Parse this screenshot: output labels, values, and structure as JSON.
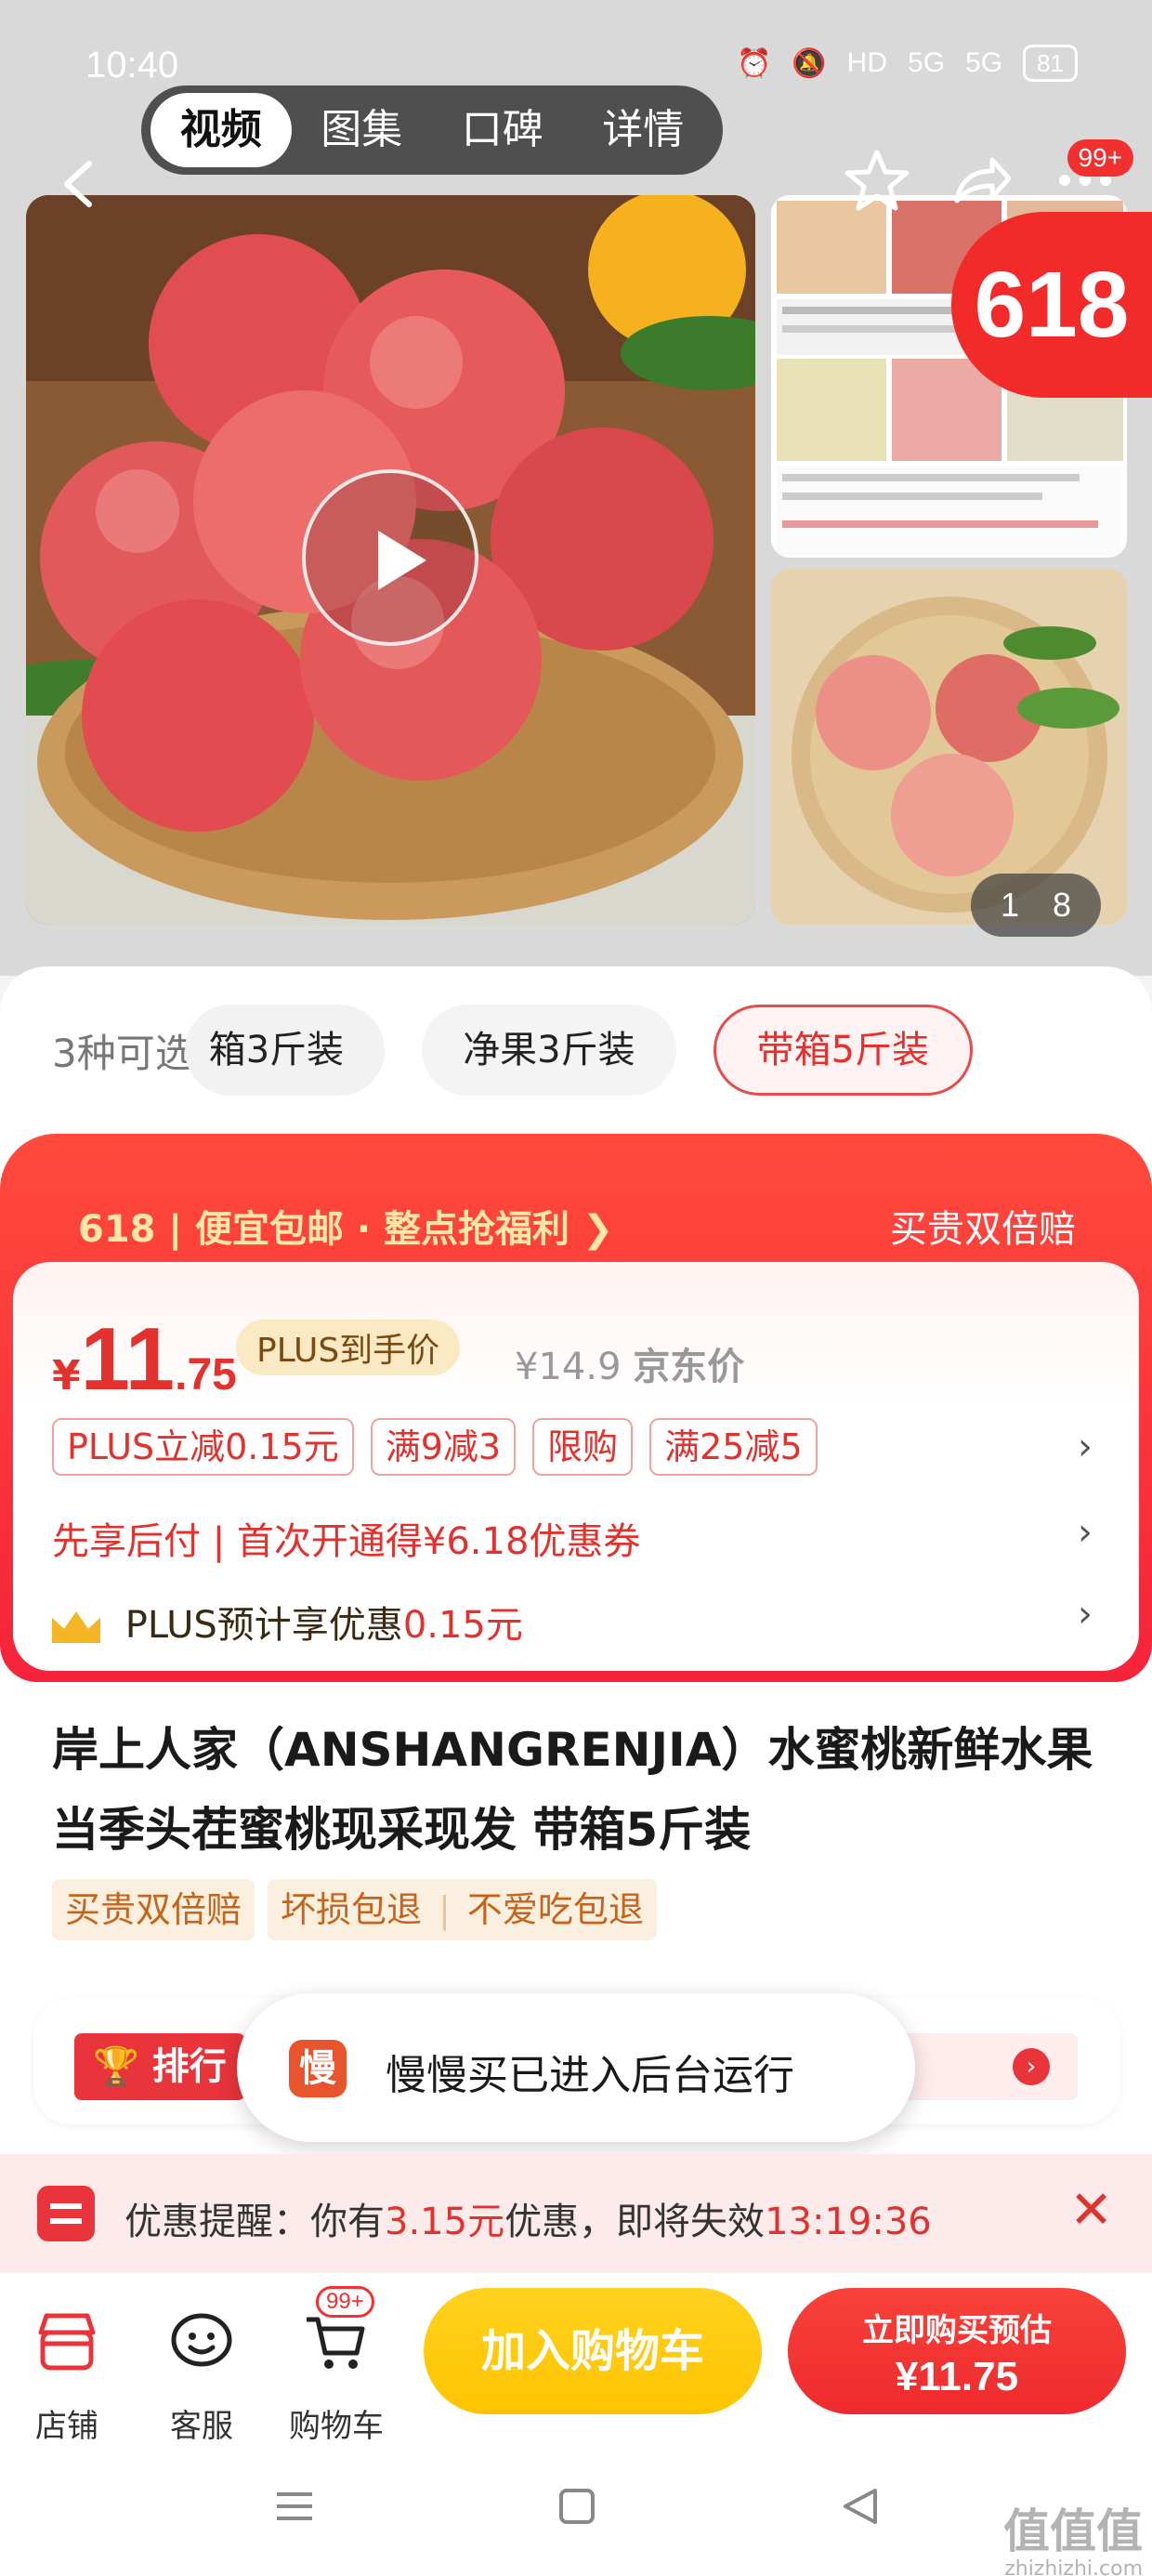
{
  "status_bar": {
    "time": "10:40",
    "hd": "HD",
    "net1": "5G",
    "net2": "5G",
    "battery": "81"
  },
  "media_tabs": [
    {
      "label": "视频",
      "active": true
    },
    {
      "label": "图集",
      "active": false
    },
    {
      "label": "口碑",
      "active": false
    },
    {
      "label": "详情",
      "active": false
    }
  ],
  "header": {
    "cart_badge": "99+",
    "promo_badge": "618",
    "image_counter": "1 8"
  },
  "variants": {
    "count_label": "3种可选",
    "options": [
      {
        "label": "箱3斤装",
        "active": false
      },
      {
        "label": "净果3斤装",
        "active": false
      },
      {
        "label": "带箱5斤装",
        "active": true
      }
    ]
  },
  "promo": {
    "title": "618 | 便宜包邮 · 整点抢福利 ❯",
    "right": "买贵双倍赔"
  },
  "price": {
    "currency": "¥",
    "integer": "11",
    "decimal": ".75",
    "plus_tag": "PLUS到手价",
    "jd_price": "¥14.9",
    "jd_label": "京东价"
  },
  "coupons": [
    "PLUS立减0.15元",
    "满9减3",
    "限购",
    "满25减5"
  ],
  "pay_later": "先享后付 | 首次开通得¥6.18优惠券",
  "plus_saving": {
    "prefix": "PLUS预计享优惠",
    "amount": "0.15元"
  },
  "product_title": "岸上人家（ANSHANGRENJIA）水蜜桃新鲜水果当季头茬蜜桃现采现发 带箱5斤装",
  "service_tags": [
    "买贵双倍赔",
    "坏损包退",
    "不爱吃包退"
  ],
  "ranking": {
    "label": "排行"
  },
  "toast": {
    "icon_text": "慢",
    "text": "慢慢买已进入后台运行"
  },
  "reminder": {
    "prefix": "优惠提醒：你有",
    "amount": "3.15元",
    "middle": "优惠，即将失效",
    "countdown": "13:19:36"
  },
  "bottom_bar": {
    "store": "店铺",
    "service": "客服",
    "cart": "购物车",
    "cart_badge": "99+",
    "add_to_cart": "加入购物车",
    "buy_line1": "立即购买预估",
    "buy_line2": "¥11.75"
  },
  "watermark": {
    "text": "值值值",
    "url": "zhizhizhi.com"
  }
}
